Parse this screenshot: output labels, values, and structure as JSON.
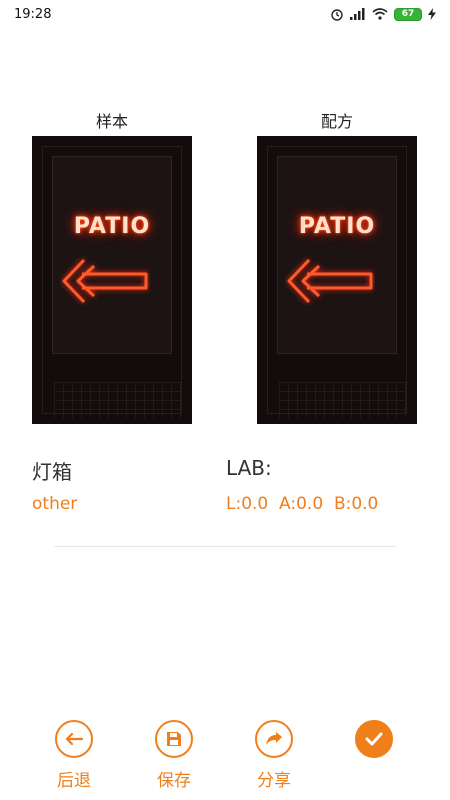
{
  "status": {
    "time": "19:28",
    "battery": "67"
  },
  "columns": {
    "sample_label": "样本",
    "formula_label": "配方"
  },
  "thumbnail": {
    "neon_text": "PATIO"
  },
  "properties": {
    "type_label": "灯箱",
    "type_value": "other",
    "lab_label": "LAB:",
    "lab_value": "L:0.0  A:0.0  B:0.0"
  },
  "toolbar": {
    "back_label": "后退",
    "save_label": "保存",
    "share_label": "分享"
  },
  "colors": {
    "accent": "#f07f1b"
  },
  "icons": [
    "back-arrow-icon",
    "floppy-disk-icon",
    "share-arrow-icon",
    "check-icon",
    "wifi-icon",
    "signal-icon",
    "alarm-icon",
    "battery-icon",
    "charging-icon"
  ]
}
